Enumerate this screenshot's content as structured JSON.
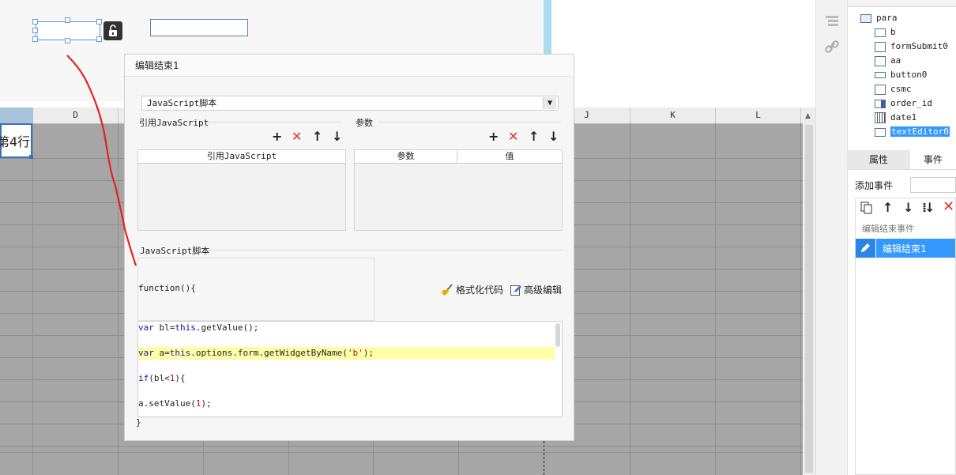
{
  "canvas": {
    "lock_icon": "unlock-icon"
  },
  "sheet": {
    "columns": [
      "D",
      "J",
      "K",
      "L"
    ],
    "selected_cell_text": "第4行"
  },
  "tree": {
    "items": [
      {
        "label": "para",
        "icon": "form-icon"
      },
      {
        "label": "b",
        "icon": "textbox-icon"
      },
      {
        "label": "formSubmit0",
        "icon": "submit-icon"
      },
      {
        "label": "aa",
        "icon": "number-icon"
      },
      {
        "label": "button0",
        "icon": "button-icon"
      },
      {
        "label": "csmc",
        "icon": "number-icon"
      },
      {
        "label": "order_id",
        "icon": "dropdown-icon"
      },
      {
        "label": "date1",
        "icon": "calendar-icon"
      },
      {
        "label": "textEditor0",
        "icon": "textbox-icon"
      }
    ]
  },
  "panel": {
    "tab_props": "属性",
    "tab_events": "事件",
    "add_event_label": "添加事件",
    "event_group": "编辑结束事件",
    "event_item": "编辑结束1"
  },
  "dialog": {
    "title": "编辑结束1",
    "select_value": "JavaScript脚本",
    "ref_js_label": "引用JavaScript",
    "params_label": "参数",
    "ref_js_col": "引用JavaScript",
    "param_col": "参数",
    "value_col": "值",
    "script_label": "JavaScript脚本",
    "function_open": "function(){",
    "format_btn": "格式化代码",
    "advanced_btn": "高级编辑",
    "function_close": "}",
    "code_lines": [
      "var bl=this.getValue();",
      "var a=this.options.form.getWidgetByName('b');",
      "if(bl<1){",
      "a.setValue(1);"
    ]
  },
  "colors": {
    "accent": "#3399ff",
    "selection": "#3b73b9",
    "delete": "#e03030",
    "highlight_line": "#ffffa8"
  }
}
